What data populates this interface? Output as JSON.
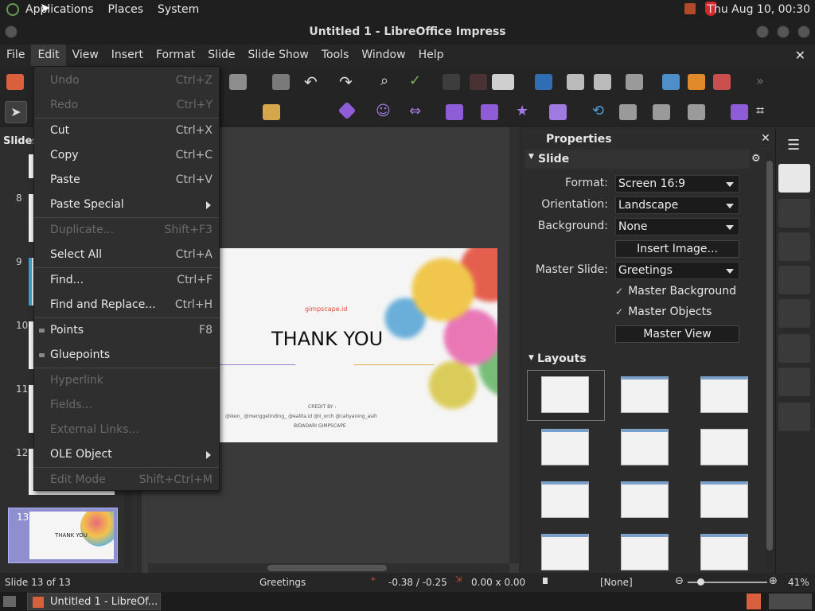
{
  "top_panel": {
    "applications": "Applications",
    "places": "Places",
    "system": "System",
    "clock": "Thu Aug 10, 00:30"
  },
  "window": {
    "title": "Untitled 1 - LibreOffice Impress"
  },
  "menubar": [
    "File",
    "Edit",
    "View",
    "Insert",
    "Format",
    "Slide",
    "Slide Show",
    "Tools",
    "Window",
    "Help"
  ],
  "edit_menu": {
    "undo": {
      "label": "Undo",
      "shortcut": "Ctrl+Z"
    },
    "redo": {
      "label": "Redo",
      "shortcut": "Ctrl+Y"
    },
    "cut": {
      "label": "Cut",
      "shortcut": "Ctrl+X"
    },
    "copy": {
      "label": "Copy",
      "shortcut": "Ctrl+C"
    },
    "paste": {
      "label": "Paste",
      "shortcut": "Ctrl+V"
    },
    "paste_special": {
      "label": "Paste Special"
    },
    "duplicate": {
      "label": "Duplicate...",
      "shortcut": "Shift+F3"
    },
    "select_all": {
      "label": "Select All",
      "shortcut": "Ctrl+A"
    },
    "find": {
      "label": "Find...",
      "shortcut": "Ctrl+F"
    },
    "find_replace": {
      "label": "Find and Replace...",
      "shortcut": "Ctrl+H"
    },
    "points": {
      "label": "Points",
      "shortcut": "F8"
    },
    "gluepoints": {
      "label": "Gluepoints"
    },
    "hyperlink": {
      "label": "Hyperlink"
    },
    "fields": {
      "label": "Fields..."
    },
    "external_links": {
      "label": "External Links..."
    },
    "ole_object": {
      "label": "OLE Object"
    },
    "edit_mode": {
      "label": "Edit Mode",
      "shortcut": "Shift+Ctrl+M"
    }
  },
  "slides_pane": {
    "header": "Slides",
    "numbers": [
      "8",
      "9",
      "10",
      "11",
      "12",
      "13"
    ],
    "thumb13_text": "THANK YOU"
  },
  "slide": {
    "brand": "gimpscape.id",
    "title": "THANK YOU",
    "credit_label": "CREDIT BY :",
    "credits": "@iken_   @menggelinding_   @ealita.id   @ii_orch   @cahyaning_asih",
    "footer": "BIDADARI GIMPSCAPE"
  },
  "properties": {
    "header": "Properties",
    "slide_section": "Slide",
    "format_label": "Format:",
    "format_value": "Screen 16:9",
    "orientation_label": "Orientation:",
    "orientation_value": "Landscape",
    "background_label": "Background:",
    "background_value": "None",
    "insert_image": "Insert Image...",
    "master_slide_label": "Master Slide:",
    "master_slide_value": "Greetings",
    "master_background": "Master Background",
    "master_objects": "Master Objects",
    "master_view": "Master View",
    "layouts_section": "Layouts"
  },
  "statusbar": {
    "slide": "Slide 13 of 13",
    "master": "Greetings",
    "position": "-0.38 / -0.25",
    "size": "0.00 x 0.00",
    "language": "[None]",
    "zoom": "41%"
  },
  "taskbar": {
    "window": "Untitled 1 - LibreOf..."
  },
  "colors": {
    "accent_red": "#e04c3c",
    "panel_bg": "#2c2c2c",
    "menu_bg": "#2f2f2f",
    "selected_thumb": "#8f8fd0"
  }
}
